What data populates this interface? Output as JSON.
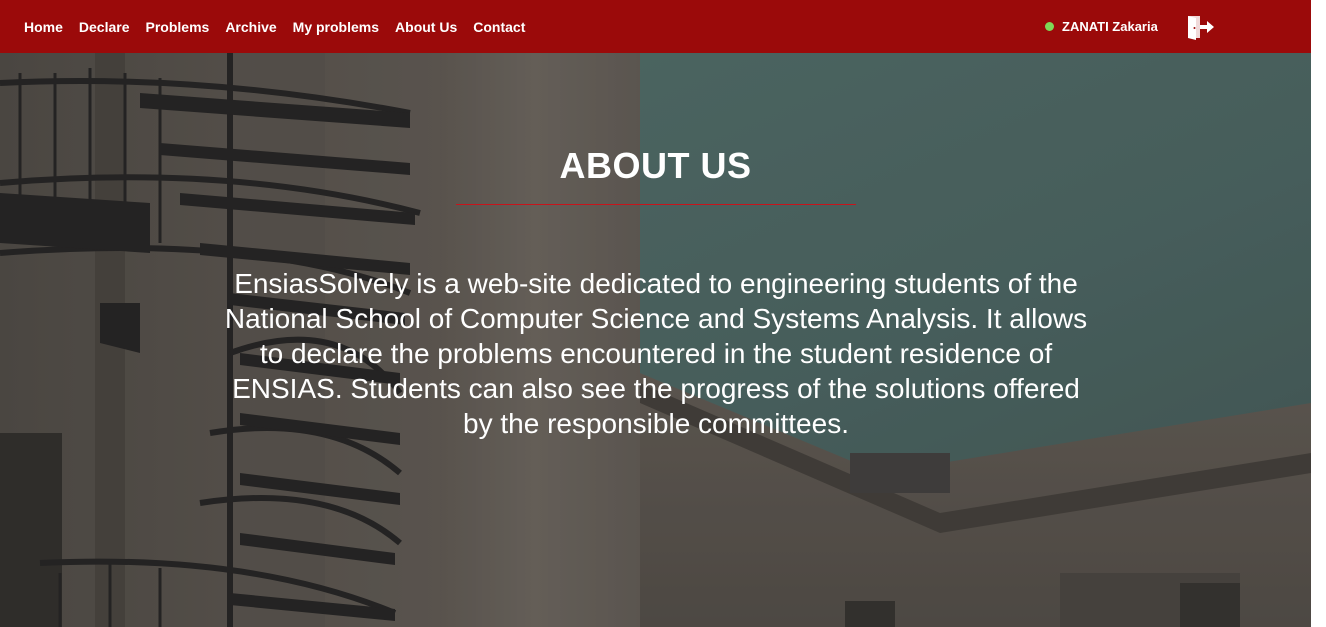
{
  "nav": {
    "items": [
      {
        "label": "Home"
      },
      {
        "label": "Declare"
      },
      {
        "label": "Problems"
      },
      {
        "label": "Archive"
      },
      {
        "label": "My problems"
      },
      {
        "label": "About Us"
      },
      {
        "label": "Contact"
      }
    ],
    "user": {
      "name": "ZANATI Zakaria",
      "status_color": "#7ed957"
    },
    "logout_icon": "logout-door-icon",
    "background_color": "#9b0a0a"
  },
  "about": {
    "title": "ABOUT US",
    "text": "EnsiasSolvely is a web-site dedicated to engineering students of the National School of Computer Science and Systems Analysis. It allows to declare the problems encountered in the student residence of ENSIAS. Students can also see the progress of the solutions offered by the responsible committees.",
    "accent_color": "#c8141b"
  }
}
